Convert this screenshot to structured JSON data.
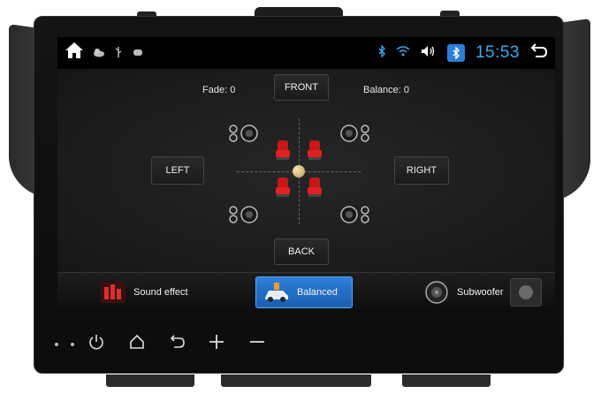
{
  "statusbar": {
    "home_icon": "home-icon",
    "weather_icon": "weather-icon",
    "usb_icon": "usb-icon",
    "android_icon": "android-icon",
    "bluetooth_icon": "bluetooth-icon",
    "wifi_icon": "wifi-icon",
    "volume_icon": "volume-icon",
    "bluetooth_app_icon": "bluetooth-app-icon",
    "time": "15:53",
    "back_icon": "back-icon"
  },
  "balance_panel": {
    "fade_label": "Fade:",
    "fade_value": "0",
    "balance_label": "Balance:",
    "balance_value": "0",
    "front_label": "FRONT",
    "back_label": "BACK",
    "left_label": "LEFT",
    "right_label": "RIGHT"
  },
  "tabs": [
    {
      "label": "Sound effect",
      "icon": "equalizer-icon",
      "active": false
    },
    {
      "label": "Balanced",
      "icon": "car-balance-icon",
      "active": true
    },
    {
      "label": "Subwoofer",
      "icon": "subwoofer-icon",
      "active": false
    }
  ],
  "hardware_keys": [
    "power-icon",
    "home-icon",
    "back-icon",
    "volume-up-icon",
    "volume-down-icon"
  ],
  "colors": {
    "accent": "#3fa9e8",
    "active_tab": "#2c7fd8",
    "seat_red": "#c81818"
  }
}
